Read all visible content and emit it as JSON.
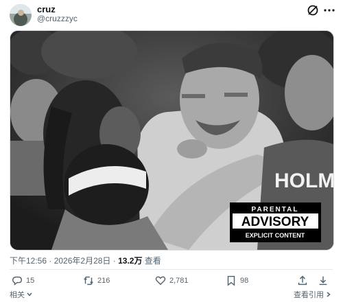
{
  "author": {
    "display_name": "cruz",
    "handle": "@cruzzzyc"
  },
  "post": {
    "time": "下午12:56",
    "separator": " · ",
    "date": "2026年2月28日",
    "views_count": "13.2万",
    "views_label": "查看"
  },
  "media": {
    "jersey_text": "HOLM",
    "advisory": {
      "line1": "PARENTAL",
      "line2": "ADVISORY",
      "line3": "EXPLICIT CONTENT"
    }
  },
  "actions": {
    "replies": "15",
    "reposts": "216",
    "likes": "2,781",
    "bookmarks": "98"
  },
  "footer": {
    "related": "相关",
    "view_quotes": "查看引用"
  },
  "icons": [
    "grok-icon",
    "more-icon",
    "reply-icon",
    "repost-icon",
    "like-icon",
    "bookmark-icon",
    "share-icon",
    "download-icon",
    "chevron-down-icon",
    "chevron-right-icon"
  ]
}
